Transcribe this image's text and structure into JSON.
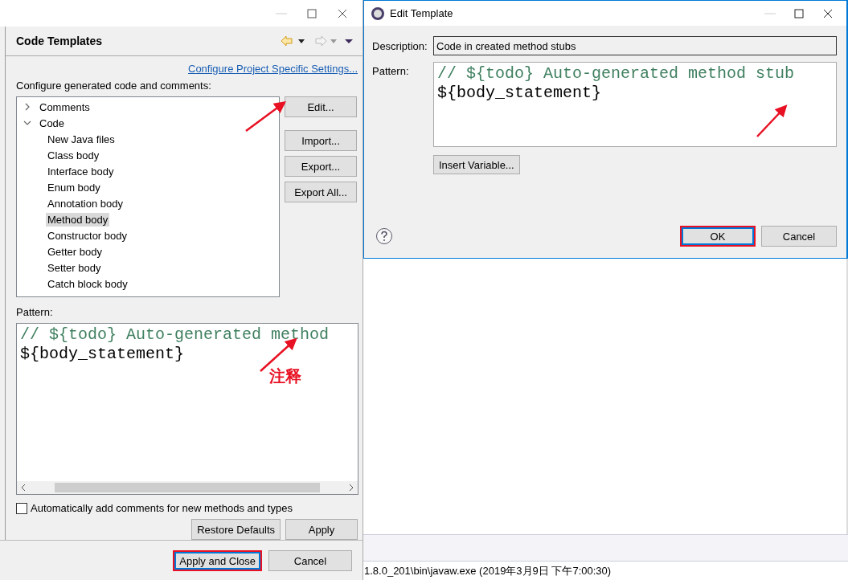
{
  "preferences": {
    "title": "Code Templates",
    "link": "Configure Project Specific Settings...",
    "intro": "Configure generated code and comments:",
    "tree": [
      {
        "label": "Comments",
        "expanded": false,
        "selected": false
      },
      {
        "label": "Code",
        "expanded": true,
        "selected": false,
        "children": [
          {
            "label": "New Java files",
            "selected": false
          },
          {
            "label": "Class body",
            "selected": false
          },
          {
            "label": "Interface body",
            "selected": false
          },
          {
            "label": "Enum body",
            "selected": false
          },
          {
            "label": "Annotation body",
            "selected": false
          },
          {
            "label": "Method body",
            "selected": true
          },
          {
            "label": "Constructor body",
            "selected": false
          },
          {
            "label": "Getter body",
            "selected": false
          },
          {
            "label": "Setter body",
            "selected": false
          },
          {
            "label": "Catch block body",
            "selected": false
          }
        ]
      }
    ],
    "side_buttons": [
      "Edit...",
      "Import...",
      "Export...",
      "Export All..."
    ],
    "pattern_label": "Pattern:",
    "pattern": [
      {
        "kind": "comment",
        "text": "// ${todo} Auto-generated method"
      },
      {
        "kind": "code",
        "text": "${body_statement}"
      }
    ],
    "auto_comments": {
      "label": "Automatically add comments for new methods and types",
      "checked": false
    },
    "buttons": [
      {
        "label": "Restore Defaults"
      },
      {
        "label": "Apply"
      }
    ],
    "footer_buttons": [
      {
        "label": "Apply and Close",
        "highlighted": true
      },
      {
        "label": "Cancel",
        "highlighted": false
      }
    ]
  },
  "edit_template": {
    "title": "Edit Template",
    "description_label": "Description:",
    "description": "Code in created method stubs",
    "pattern_label": "Pattern:",
    "pattern": [
      {
        "kind": "comment",
        "text": "// ${todo} Auto-generated method stub"
      },
      {
        "kind": "code",
        "text": "${body_statement}"
      }
    ],
    "insert_button": "Insert Variable...",
    "buttons": [
      {
        "label": "OK",
        "highlighted": true
      },
      {
        "label": "Cancel",
        "highlighted": false
      }
    ]
  },
  "annotation": {
    "text": "注释"
  },
  "console_status": "1.8.0_201\\bin\\javaw.exe (2019年3月9日 下午7:00:30)"
}
